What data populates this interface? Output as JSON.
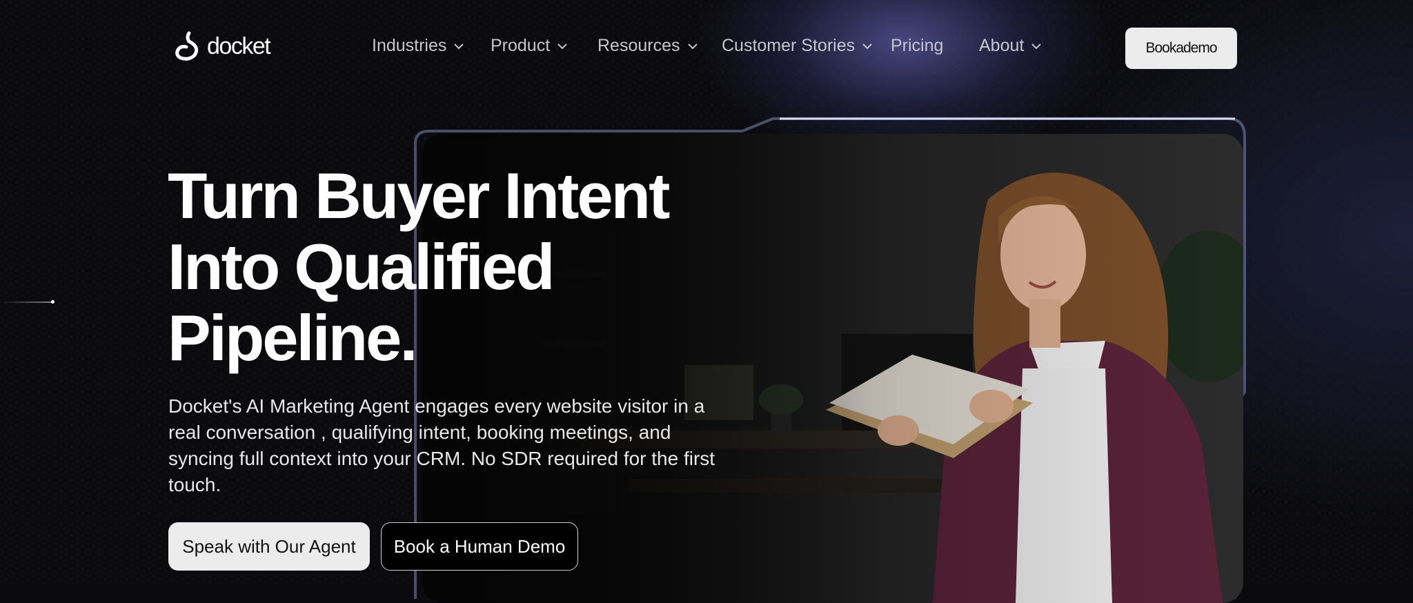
{
  "nav": {
    "logo_text": "docket",
    "items": [
      {
        "label": "Industries",
        "has_dropdown": true
      },
      {
        "label": "Product",
        "has_dropdown": true
      },
      {
        "label": "Resources",
        "has_dropdown": true
      },
      {
        "label": "Customer Stories",
        "has_dropdown": true
      },
      {
        "label": "Pricing",
        "has_dropdown": false
      },
      {
        "label": "About",
        "has_dropdown": true
      }
    ],
    "cta_label": "Bookademo"
  },
  "hero": {
    "title_lines": [
      "Turn Buyer Intent",
      "Into Qualified",
      "Pipeline."
    ],
    "description": "Docket's AI Marketing Agent engages every website visitor in a real conversation , qualifying intent, booking meetings, and syncing full context into your CRM. No SDR required for the first touch.",
    "primary_cta": "Speak with Our Agent",
    "secondary_cta": "Book a Human Demo"
  },
  "colors": {
    "background": "#0b0b0d",
    "accent_glow": "#7878dc",
    "button_light": "#ececec",
    "cardigan": "#5a2238"
  },
  "icons": {
    "logo": "docket-logo-icon",
    "dropdown": "chevron-down-icon"
  }
}
